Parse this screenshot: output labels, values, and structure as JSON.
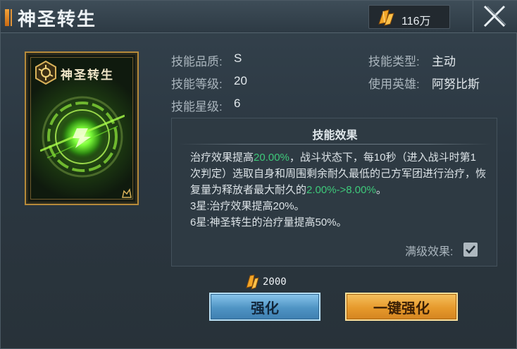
{
  "header": {
    "title": "神圣转生",
    "currency_amount": "116万",
    "accent_color": "#e39538"
  },
  "card": {
    "name": "神圣转生",
    "frame_color": "#b68a3a",
    "glow_color": "#7dff3a"
  },
  "info": {
    "quality_label": "技能品质:",
    "quality_value": "S",
    "level_label": "技能等级:",
    "level_value": "20",
    "star_label": "技能星级:",
    "star_value": "6",
    "type_label": "技能类型:",
    "type_value": "主动",
    "hero_label": "使用英雄:",
    "hero_value": "阿努比斯"
  },
  "effect": {
    "title": "技能效果",
    "line1_a": "治疗效果提高",
    "line1_hl": "20.00%",
    "line1_b": "，战斗状态下，每10秒（进入战斗时第1次判定）选取自身和周围剩余耐久最低的己方军团进行治疗，恢复量为释放者最大耐久的",
    "line1_hl2": "2.00%->8.00%",
    "line1_c": "。",
    "star3": "3星:治疗效果提高20%。",
    "star6": "6星:神圣转生的治疗量提高50%。",
    "highlight_color": "#3ec97a"
  },
  "max_level": {
    "label": "满级效果:",
    "checked": true
  },
  "cost": {
    "amount": "2000"
  },
  "buttons": {
    "upgrade": "强化",
    "one_click_upgrade": "一键强化"
  }
}
